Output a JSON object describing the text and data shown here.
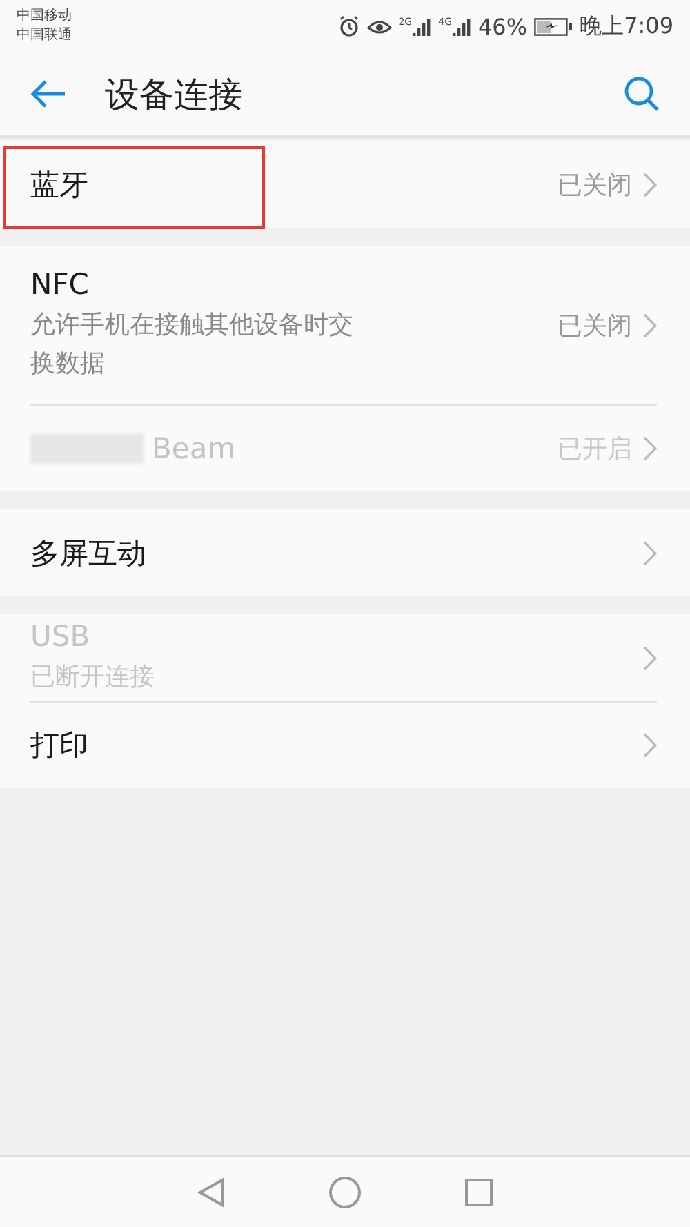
{
  "status_bar": {
    "carriers": [
      "中国移动",
      "中国联通"
    ],
    "signals": [
      {
        "label": "2G"
      },
      {
        "label": "4G"
      }
    ],
    "battery": "46%",
    "time": "晚上7:09"
  },
  "app_bar": {
    "title": "设备连接"
  },
  "groups": [
    {
      "items": [
        {
          "title": "蓝牙",
          "status": "已关闭",
          "disabled": false,
          "highlighted": true
        }
      ]
    },
    {
      "items": [
        {
          "title": "NFC",
          "subtitle": "允许手机在接触其他设备时交换数据",
          "status": "已关闭",
          "disabled": false,
          "highlighted": false
        },
        {
          "title": "Beam",
          "redacted_prefix": true,
          "status": "已开启",
          "disabled": true,
          "highlighted": false
        }
      ]
    },
    {
      "items": [
        {
          "title": "多屏互动",
          "disabled": false,
          "highlighted": false
        }
      ]
    },
    {
      "items": [
        {
          "title": "USB",
          "subtitle": "已断开连接",
          "disabled": true,
          "highlighted": false
        },
        {
          "title": "打印",
          "disabled": false,
          "highlighted": false
        }
      ]
    }
  ]
}
